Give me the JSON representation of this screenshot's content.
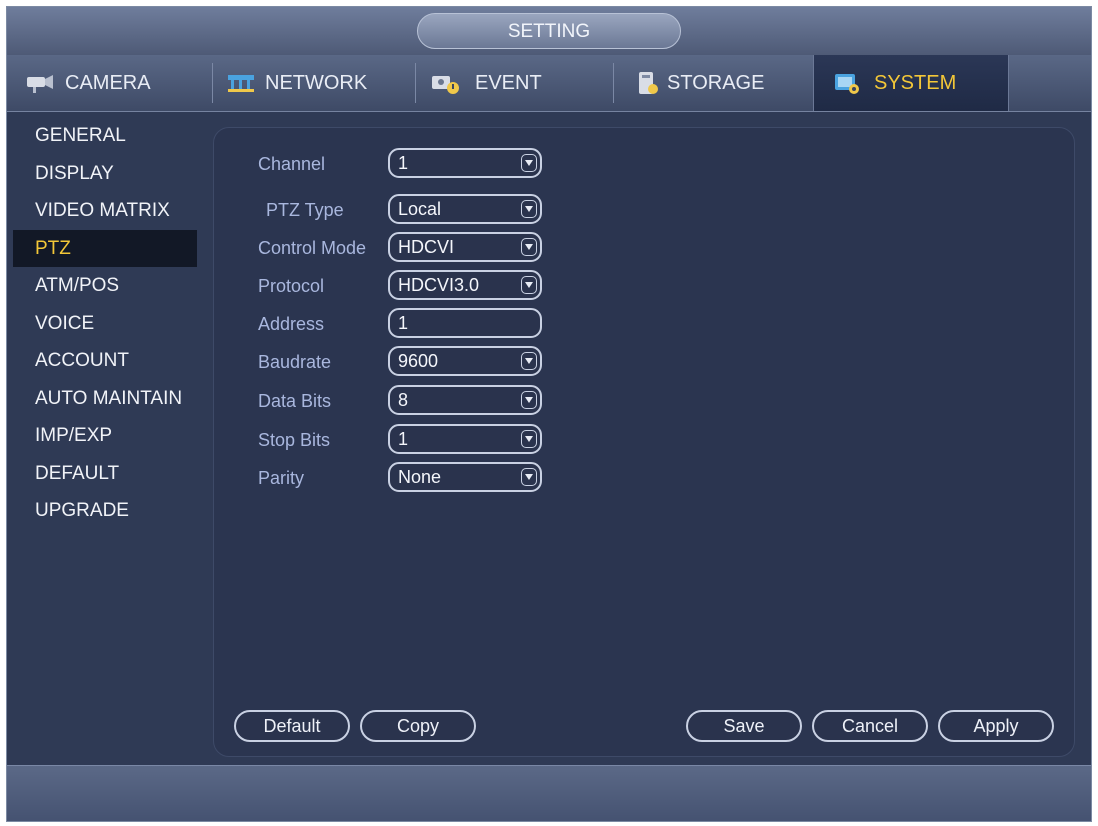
{
  "window": {
    "title": "SETTING"
  },
  "tabs": [
    {
      "label": "CAMERA",
      "icon": "camera-icon"
    },
    {
      "label": "NETWORK",
      "icon": "network-icon"
    },
    {
      "label": "EVENT",
      "icon": "event-icon"
    },
    {
      "label": "STORAGE",
      "icon": "storage-icon"
    },
    {
      "label": "SYSTEM",
      "icon": "system-icon",
      "active": true
    }
  ],
  "sidebar": {
    "items": [
      {
        "label": "GENERAL"
      },
      {
        "label": "DISPLAY"
      },
      {
        "label": "VIDEO MATRIX"
      },
      {
        "label": "PTZ",
        "active": true
      },
      {
        "label": "ATM/POS"
      },
      {
        "label": "VOICE"
      },
      {
        "label": "ACCOUNT"
      },
      {
        "label": "AUTO MAINTAIN"
      },
      {
        "label": "IMP/EXP"
      },
      {
        "label": "DEFAULT"
      },
      {
        "label": "UPGRADE"
      }
    ]
  },
  "form": {
    "channel": {
      "label": "Channel",
      "value": "1"
    },
    "ptz_type": {
      "label": "PTZ Type",
      "value": "Local"
    },
    "control_mode": {
      "label": "Control Mode",
      "value": "HDCVI"
    },
    "protocol": {
      "label": "Protocol",
      "value": "HDCVI3.0"
    },
    "address": {
      "label": "Address",
      "value": "1"
    },
    "baudrate": {
      "label": "Baudrate",
      "value": "9600"
    },
    "data_bits": {
      "label": "Data Bits",
      "value": "8"
    },
    "stop_bits": {
      "label": "Stop Bits",
      "value": "1"
    },
    "parity": {
      "label": "Parity",
      "value": "None"
    }
  },
  "buttons": {
    "default": "Default",
    "copy": "Copy",
    "save": "Save",
    "cancel": "Cancel",
    "apply": "Apply"
  },
  "colors": {
    "accent": "#f3c738",
    "background": "#2f3a55",
    "panel": "#2b3550",
    "label": "#a9b7de"
  }
}
